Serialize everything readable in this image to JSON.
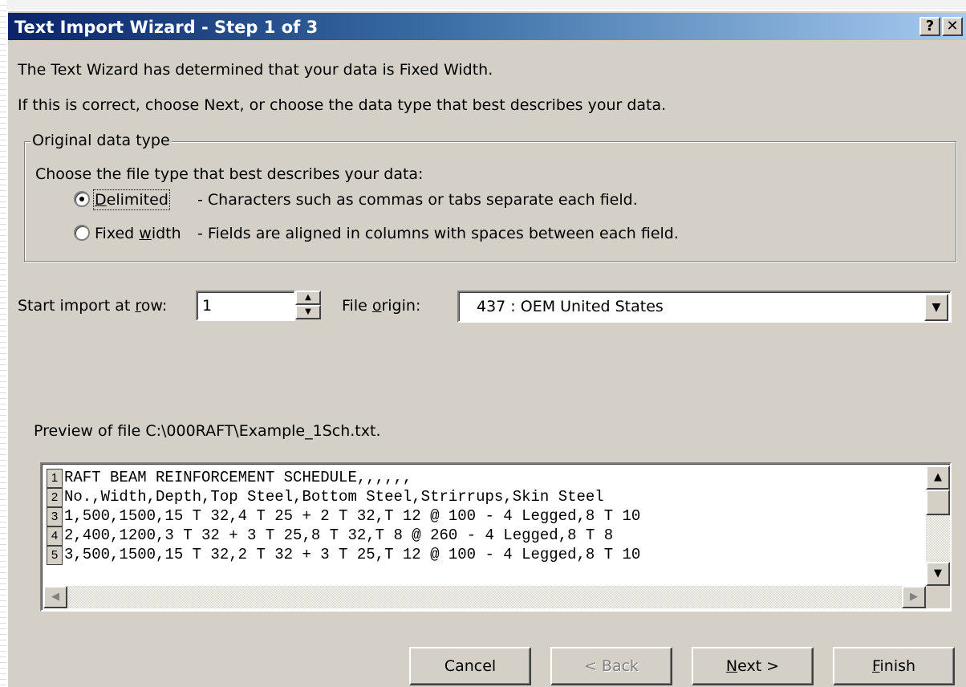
{
  "window": {
    "title": "Text Import Wizard - Step 1 of 3",
    "help_button": "?",
    "close_button": "✕"
  },
  "intro": {
    "line1": "The Text Wizard has determined that your data is Fixed Width.",
    "line2": "If this is correct, choose Next, or choose the data type that best describes your data."
  },
  "data_type_group": {
    "legend": "Original data type",
    "prompt": "Choose the file type that best describes your data:",
    "options": [
      {
        "label_pre": "",
        "label_acc": "D",
        "label_post": "elimited",
        "description": "- Characters such as commas or tabs separate each field.",
        "selected": true
      },
      {
        "label_pre": "Fixed ",
        "label_acc": "w",
        "label_post": "idth",
        "description": "- Fields are aligned in columns with spaces between each field.",
        "selected": false
      }
    ]
  },
  "start_row": {
    "label_pre": "Start import at ",
    "label_acc": "r",
    "label_post": "ow:",
    "value": "1"
  },
  "file_origin": {
    "label_pre": "File ",
    "label_acc": "o",
    "label_post": "rigin:",
    "value": "437 : OEM United States"
  },
  "preview": {
    "label": "Preview of file C:\\000RAFT\\Example_1Sch.txt.",
    "rows": [
      {
        "num": "1",
        "text": "RAFT BEAM REINFORCEMENT SCHEDULE,,,,,,"
      },
      {
        "num": "2",
        "text": "No.,Width,Depth,Top Steel,Bottom Steel,Strirrups,Skin Steel"
      },
      {
        "num": "3",
        "text": "1,500,1500,15 T 32,4 T 25 + 2 T 32,T 12 @ 100 - 4 Legged,8 T 10"
      },
      {
        "num": "4",
        "text": "2,400,1200,3 T 32 + 3 T 25,8 T 32,T 8 @ 260 - 4 Legged,8 T 8"
      },
      {
        "num": "5",
        "text": "3,500,1500,15 T 32,2 T 32 + 3 T 25,T 12 @ 100 - 4 Legged,8 T 10"
      }
    ]
  },
  "buttons": {
    "cancel": "Cancel",
    "back": "< Back",
    "next_acc": "N",
    "next_rest": "ext >",
    "finish_acc": "F",
    "finish_rest": "inish"
  }
}
